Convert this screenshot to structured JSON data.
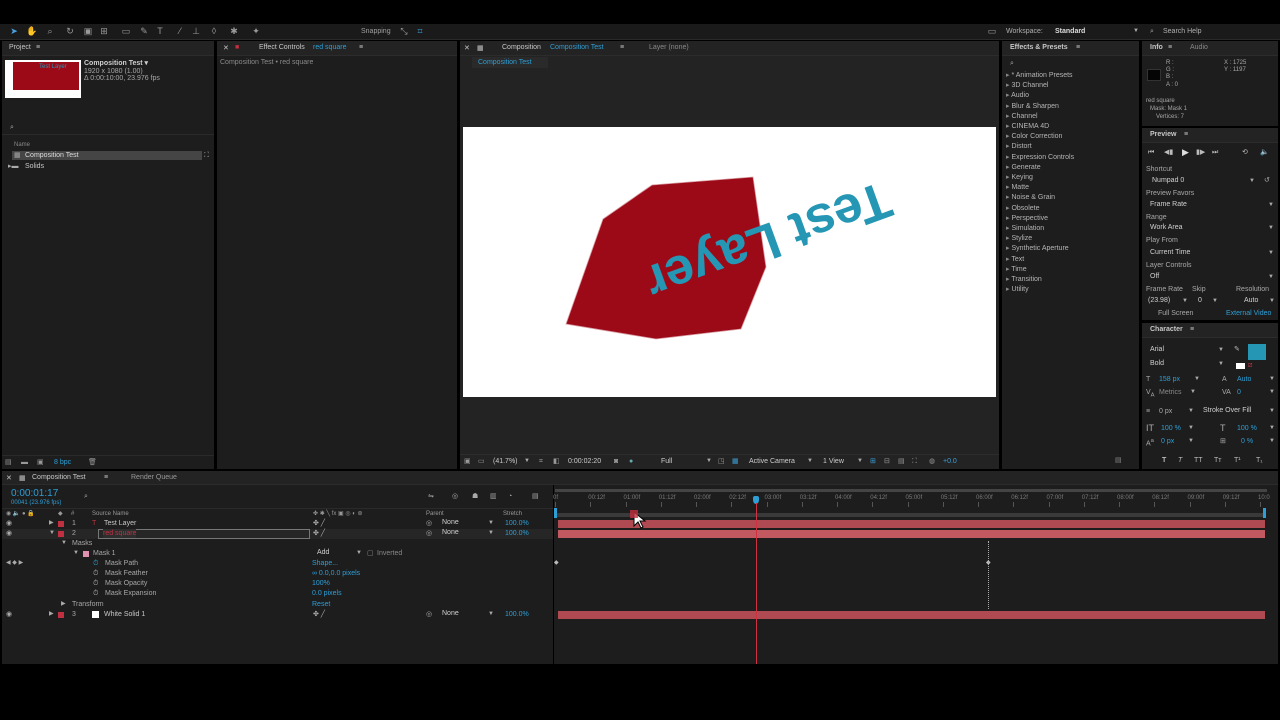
{
  "toolbar": {
    "snapping_label": "Snapping",
    "workspace_label": "Workspace:",
    "workspace_value": "Standard",
    "search_help_placeholder": "Search Help"
  },
  "project": {
    "tab": "Project",
    "thumb_label": "Test Layer",
    "comp_name": "Composition Test ▾",
    "comp_size": "1920 x 1080 (1.00)",
    "comp_duration": "Δ 0:00:10:00, 23.976 fps",
    "col_name": "Name",
    "items": [
      "Composition Test",
      "Solids"
    ],
    "bpc": "8 bpc"
  },
  "effect_controls": {
    "tab_prefix": "Effect Controls",
    "tab_layer": "red square",
    "sub": "Composition Test • red square"
  },
  "composition": {
    "tab_prefix": "Composition",
    "tab_name": "Composition Test",
    "layer_tab": "Layer (none)",
    "view_tab": "Composition Test",
    "canvas_text": "Test Layer",
    "zoom": "(41.7%)",
    "time": "0:00:02:20",
    "resolution": "Full",
    "camera": "Active Camera",
    "views": "1 View",
    "exposure": "+0.0",
    "shape_color": "#9c0a18",
    "text_color": "#2596b4"
  },
  "effects_presets": {
    "tab": "Effects & Presets",
    "items": [
      "* Animation Presets",
      "3D Channel",
      "Audio",
      "Blur & Sharpen",
      "Channel",
      "CINEMA 4D",
      "Color Correction",
      "Distort",
      "Expression Controls",
      "Generate",
      "Keying",
      "Matte",
      "Noise & Grain",
      "Obsolete",
      "Perspective",
      "Simulation",
      "Stylize",
      "Synthetic Aperture",
      "Text",
      "Time",
      "Transition",
      "Utility"
    ]
  },
  "info": {
    "tab": "Info",
    "tab2": "Audio",
    "r": "R :",
    "g": "G :",
    "b": "B :",
    "a": "A : 0",
    "x": "X : 1725",
    "y": "Y : 1197",
    "layer": "red square",
    "mask": "Mask: Mask 1",
    "vertices": "Vertices: 7"
  },
  "preview": {
    "tab": "Preview",
    "shortcut_label": "Shortcut",
    "shortcut_value": "Numpad 0",
    "favors_label": "Preview Favors",
    "favors_value": "Frame Rate",
    "range_label": "Range",
    "range_value": "Work Area",
    "play_from_label": "Play From",
    "play_from_value": "Current Time",
    "layer_controls_label": "Layer Controls",
    "layer_controls_value": "Off",
    "frame_rate_label": "Frame Rate",
    "skip_label": "Skip",
    "resolution_label": "Resolution",
    "frame_rate_value": "(23.98)",
    "skip_value": "0",
    "resolution_value": "Auto",
    "full_screen": "Full Screen",
    "external_video": "External Video"
  },
  "character": {
    "tab": "Character",
    "font": "Arial",
    "style": "Bold",
    "size": "158 px",
    "leading": "Auto",
    "kerning": "Metrics",
    "tracking": "0",
    "stroke_width": "0 px",
    "stroke_mode": "Stroke Over Fill",
    "vscale": "100 %",
    "hscale": "100 %",
    "baseline": "0 px",
    "tsume": "0 %",
    "fill_color": "#2596b4"
  },
  "timeline": {
    "tab": "Composition Test",
    "render_queue": "Render Queue",
    "timecode": "0:00:01:17",
    "frames": "00041 (23.976 fps)",
    "col_source": "Source Name",
    "col_parent": "Parent",
    "col_stretch": "Stretch",
    "ticks": [
      "0f",
      "00:12f",
      "01:00f",
      "01:12f",
      "02:00f",
      "02:12f",
      "03:00f",
      "03:12f",
      "04:00f",
      "04:12f",
      "05:00f",
      "05:12f",
      "06:00f",
      "06:12f",
      "07:00f",
      "07:12f",
      "08:00f",
      "08:12f",
      "09:00f",
      "09:12f",
      "10:0"
    ],
    "layers": [
      {
        "num": "1",
        "name": "Test Layer",
        "parent": "None",
        "stretch": "100.0%"
      },
      {
        "num": "2",
        "name": "red square",
        "parent": "None",
        "stretch": "100.0%"
      },
      {
        "num": "3",
        "name": "White Solid 1",
        "parent": "None",
        "stretch": "100.0%"
      }
    ],
    "masks_label": "Masks",
    "mask1": "Mask 1",
    "mask_mode": "Add",
    "inverted": "Inverted",
    "mask_path": "Mask Path",
    "mask_path_value": "Shape...",
    "mask_feather": "Mask Feather",
    "mask_feather_value": "∞ 0.0,0.0 pixels",
    "mask_opacity": "Mask Opacity",
    "mask_opacity_value": "100%",
    "mask_expansion": "Mask Expansion",
    "mask_expansion_value": "0.0 pixels",
    "transform": "Transform",
    "transform_value": "Reset"
  }
}
